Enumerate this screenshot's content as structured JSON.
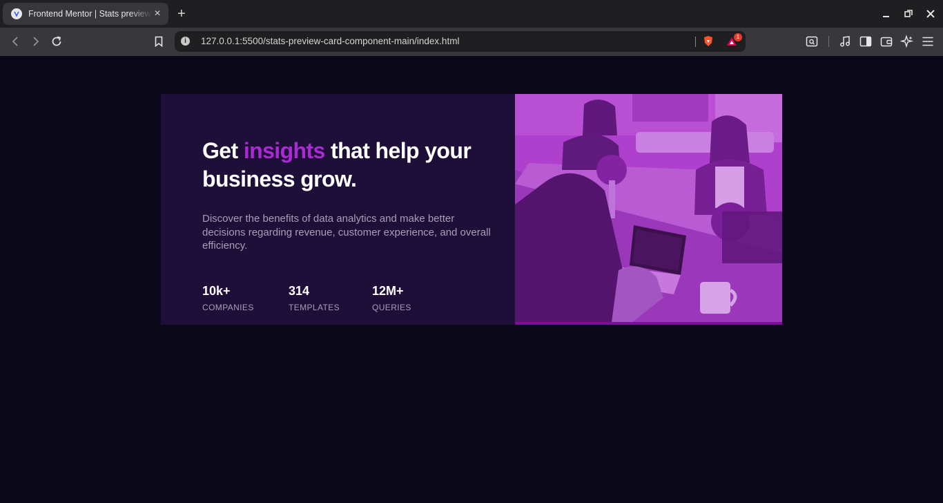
{
  "browser": {
    "tab_title": "Frontend Mentor | Stats preview card component",
    "new_tab": "+",
    "url": "127.0.0.1:5500/stats-preview-card-component-main/index.html",
    "notification_badge": "1"
  },
  "card": {
    "headline_pre": "Get ",
    "headline_accent": "insights",
    "headline_post": " that help your business grow.",
    "description": "Discover the benefits of data analytics and make better decisions regarding revenue, customer experience, and overall efficiency.",
    "stats": [
      {
        "value": "10k+",
        "label": "COMPANIES"
      },
      {
        "value": "314",
        "label": "TEMPLATES"
      },
      {
        "value": "12M+",
        "label": "QUERIES"
      }
    ]
  },
  "colors": {
    "page_bg": "#0a0819",
    "card_bg": "#1d0f38",
    "accent": "#aa2ad3",
    "photo_overlay": "#a033c9"
  },
  "icons": {
    "back": "chevron-left-icon",
    "forward": "chevron-right-icon",
    "reload": "reload-icon",
    "bookmark": "bookmark-icon",
    "site_info": "info-icon",
    "brave": "brave-shield-icon",
    "rewards": "brave-rewards-icon",
    "screenshot": "search-page-icon",
    "media": "music-note-icon",
    "sidebar": "sidebar-icon",
    "wallet": "wallet-icon",
    "leo": "leo-ai-icon",
    "menu": "hamburger-menu-icon"
  }
}
